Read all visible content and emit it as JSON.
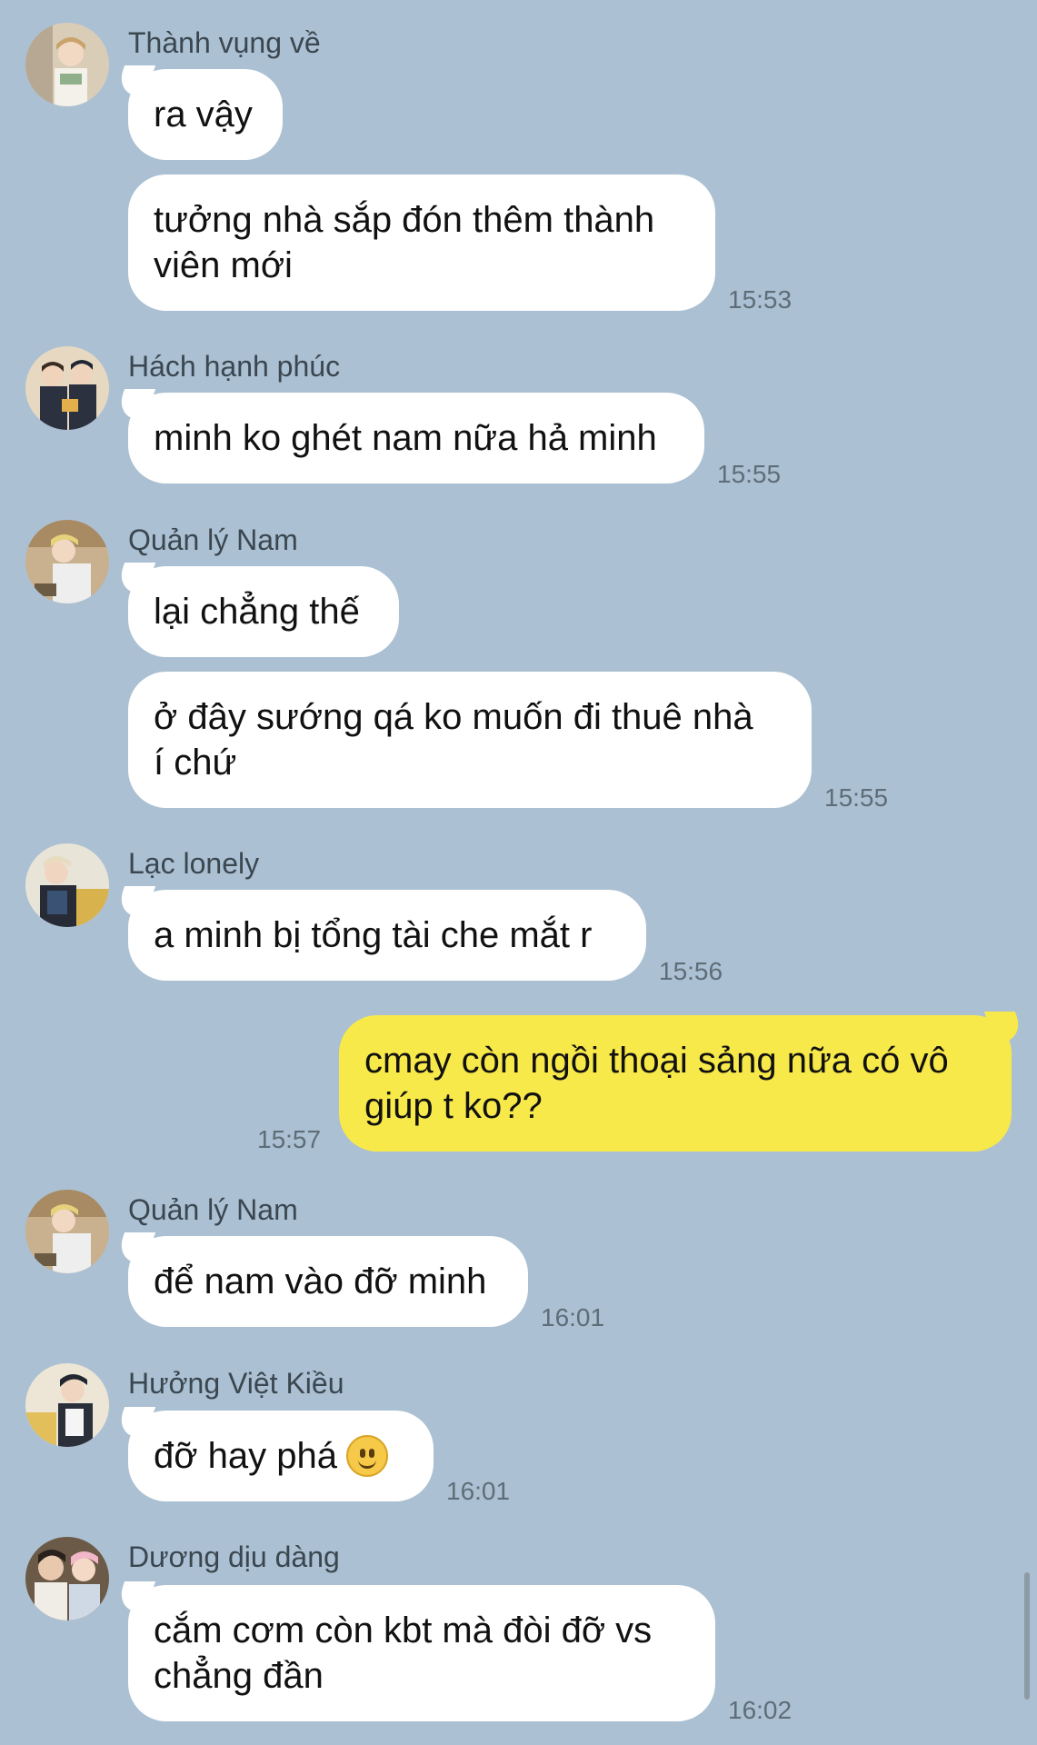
{
  "colors": {
    "background": "#abc0d2",
    "incoming_bubble": "#ffffff",
    "outgoing_bubble": "#f8e94a",
    "timestamp": "#5e6d78"
  },
  "messages": [
    {
      "sender": "Thành vụng về",
      "bubbles": [
        "ra vậy",
        "tưởng nhà sắp đón thêm thành\nviên mới"
      ],
      "time": "15:53"
    },
    {
      "sender": "Hách hạnh phúc",
      "bubbles": [
        "minh ko ghét nam nữa hả minh"
      ],
      "time": "15:55"
    },
    {
      "sender": "Quản lý Nam",
      "bubbles": [
        "lại chẳng thế",
        "ở đây sướng qá ko muốn đi thuê nhà\ní chứ"
      ],
      "time": "15:55"
    },
    {
      "sender": "Lạc lonely",
      "bubbles": [
        "a minh bị tổng tài che mắt r"
      ],
      "time": "15:56"
    },
    {
      "outgoing": true,
      "bubbles": [
        "cmay còn ngồi thoại sảng nữa có vô\ngiúp t ko??"
      ],
      "time": "15:57"
    },
    {
      "sender": "Quản lý Nam",
      "bubbles": [
        "để nam vào đỡ minh"
      ],
      "time": "16:01"
    },
    {
      "sender": "Hưởng Việt Kiều",
      "bubbles": [
        "đỡ hay phá"
      ],
      "emoji": "slightly-smiling-face-icon",
      "time": "16:01"
    },
    {
      "sender": "Dương dịu dàng",
      "bubbles": [
        "cắm cơm còn kbt mà đòi đỡ vs\nchẳng đần"
      ],
      "time": "16:02"
    }
  ]
}
